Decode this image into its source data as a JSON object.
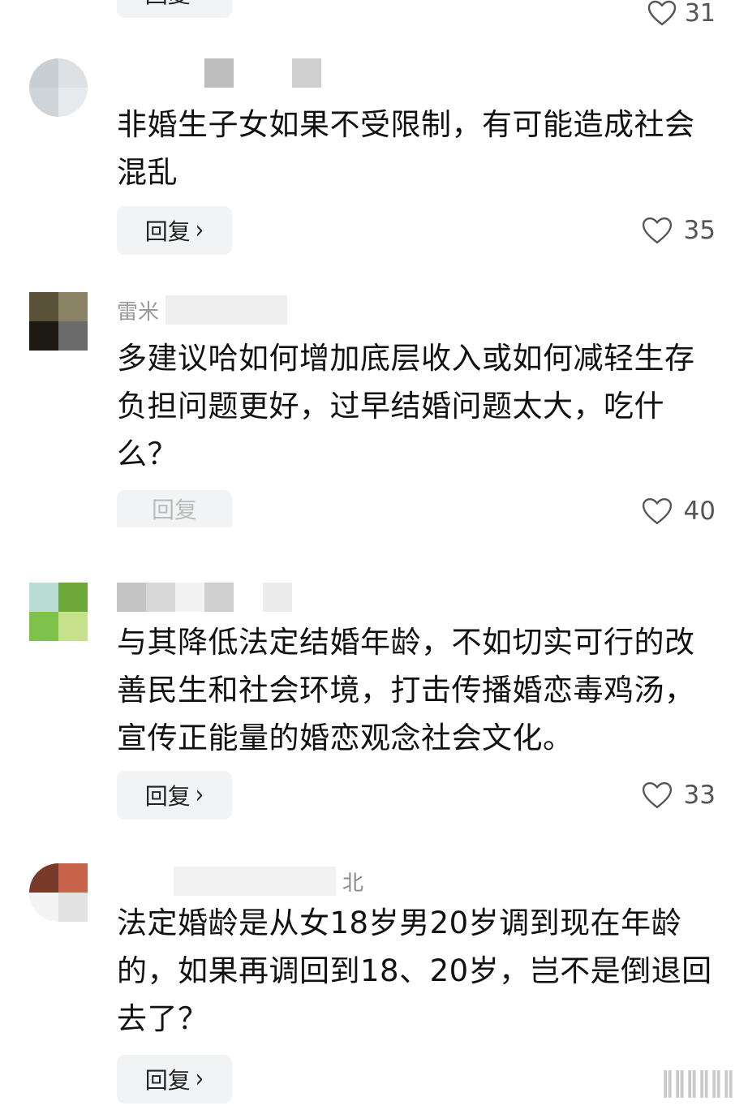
{
  "reply_label": "回复",
  "comments": [
    {
      "username_fragment": "",
      "text": "非婚生子女如果不受限制，有可能造成社会混乱",
      "likes": "35"
    },
    {
      "username_fragment": "雷米",
      "text": "多建议哈如何增加底层收入或如何减轻生存负担问题更好，过早结婚问题太大，吃什么？",
      "likes": "40"
    },
    {
      "username_fragment": "",
      "text": "与其降低法定结婚年龄，不如切实可行的改善民生和社会环境，打击传播婚恋毒鸡汤，宣传正能量的婚恋观念社会文化。",
      "likes": "33"
    },
    {
      "username_fragment": "北",
      "text": "法定婚龄是从女18岁男20岁调到现在年龄的，如果再调回到18、20岁，岂不是倒退回去了？",
      "likes": ""
    }
  ],
  "top_partial_likes": "31",
  "colors": {
    "reply_bg": "#f2f3f4",
    "text": "#111111",
    "muted": "#555555"
  },
  "icons": {
    "like": "heart-outline-icon",
    "reply_chevron": "chevron-right-icon"
  }
}
